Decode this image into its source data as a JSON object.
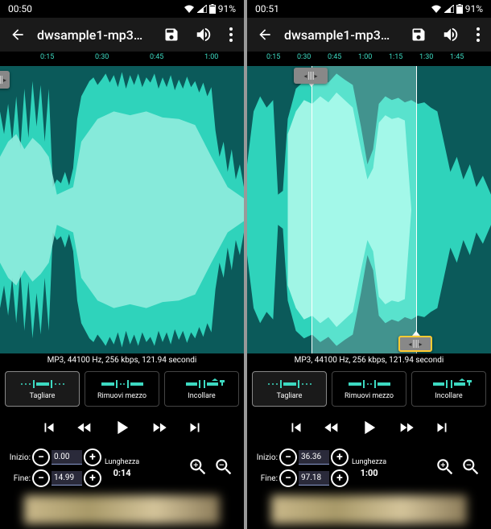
{
  "status": {
    "battery_pct": "91%",
    "wifi_icon": "wifi",
    "signal_icon": "signal",
    "battery_icon": "battery"
  },
  "app": {
    "title": "dwsample1-mp3…",
    "back_icon": "arrow-back",
    "save_icon": "save",
    "volume_icon": "volume",
    "overflow_icon": "more-vert"
  },
  "modes": {
    "cut": "Tagliare",
    "remove_mid": "Rimuovi mezzo",
    "paste": "Incollare"
  },
  "time_labels": {
    "start": "Inizio:",
    "end": "Fine:",
    "length": "Lunghezza"
  },
  "left": {
    "time": "00:50",
    "ticks": [
      "0:15",
      "0:30",
      "0:45",
      "1:00"
    ],
    "info": "MP3, 44100 Hz, 256 kbps, 121.94 secondi",
    "start_value": "0.00",
    "end_value": "14.99",
    "length_value": "0:14"
  },
  "right": {
    "time": "00:51",
    "ticks": [
      "0:15",
      "0:30",
      "0:45",
      "1:00",
      "1:15",
      "1:30",
      "1:45"
    ],
    "info": "MP3, 44100 Hz, 256 kbps, 121.94 secondi",
    "start_value": "36.36",
    "end_value": "97.18",
    "length_value": "1:00"
  }
}
